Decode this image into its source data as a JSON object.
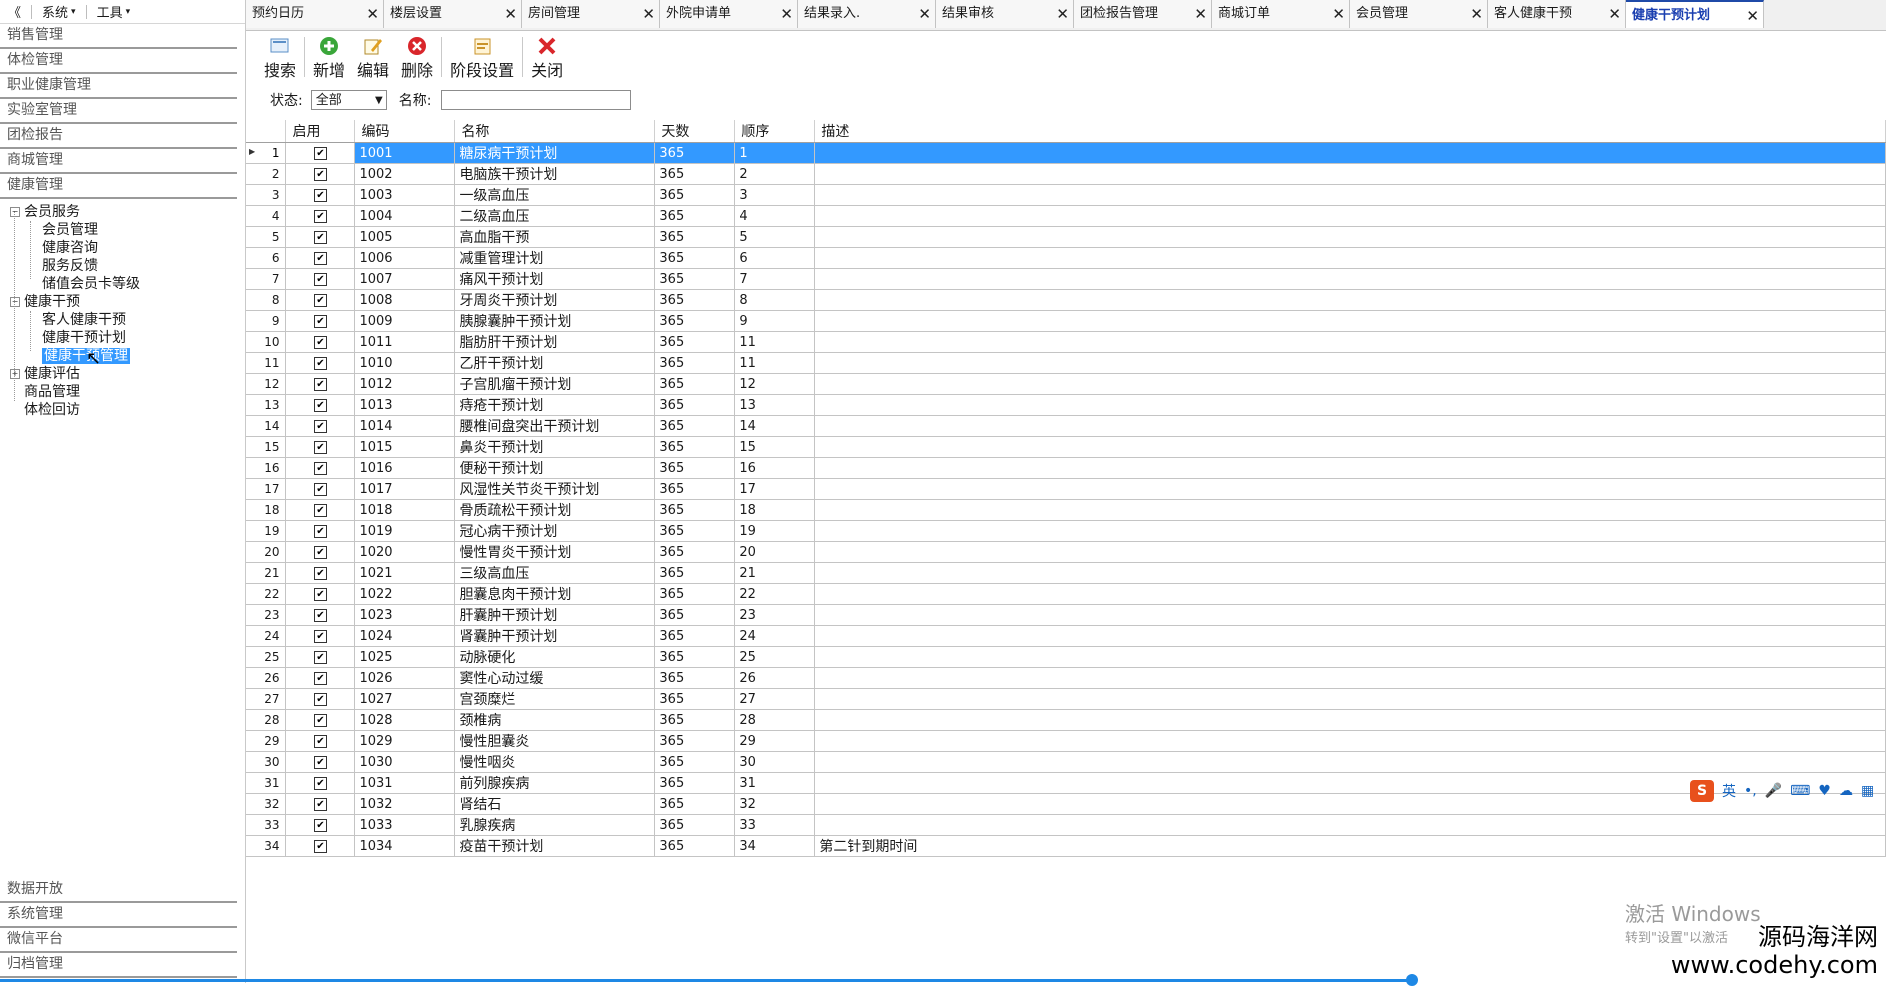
{
  "menubar": {
    "collapse": "《",
    "system": "系统",
    "tools": "工具"
  },
  "sidebar": {
    "top_groups": [
      "销售管理",
      "体检管理",
      "职业健康管理",
      "实验室管理",
      "团检报告",
      "商城管理",
      "健康管理"
    ],
    "tree": {
      "member_service": "会员服务",
      "member_children": [
        "会员管理",
        "健康咨询",
        "服务反馈",
        "储值会员卡等级"
      ],
      "health_intervention": "健康干预",
      "intervention_children": [
        "客人健康干预",
        "健康干预计划",
        "健康干预管理"
      ],
      "health_assessment": "健康评估",
      "product_management": "商品管理",
      "followup": "体检回访"
    },
    "bottom_groups": [
      "数据开放",
      "系统管理",
      "微信平台",
      "归档管理"
    ]
  },
  "tabs": [
    "预约日历",
    "楼层设置",
    "房间管理",
    "外院申请单",
    "结果录入.",
    "结果审核",
    "团检报告管理",
    "商城订单",
    "会员管理",
    "客人健康干预",
    "健康干预计划"
  ],
  "active_tab": "健康干预计划",
  "toolbar": {
    "search": "搜索",
    "add": "新增",
    "edit": "编辑",
    "delete": "删除",
    "stage": "阶段设置",
    "close": "关闭"
  },
  "filter": {
    "status_label": "状态:",
    "status_value": "全部",
    "name_label": "名称:",
    "name_value": ""
  },
  "grid": {
    "columns": [
      "启用",
      "编码",
      "名称",
      "天数",
      "顺序",
      "描述"
    ],
    "rows": [
      [
        "1",
        "1001",
        "糖尿病干预计划",
        "365",
        "1",
        ""
      ],
      [
        "2",
        "1002",
        "电脑族干预计划",
        "365",
        "2",
        ""
      ],
      [
        "3",
        "1003",
        "一级高血压",
        "365",
        "3",
        ""
      ],
      [
        "4",
        "1004",
        "二级高血压",
        "365",
        "4",
        ""
      ],
      [
        "5",
        "1005",
        "高血脂干预",
        "365",
        "5",
        ""
      ],
      [
        "6",
        "1006",
        "减重管理计划",
        "365",
        "6",
        ""
      ],
      [
        "7",
        "1007",
        "痛风干预计划",
        "365",
        "7",
        ""
      ],
      [
        "8",
        "1008",
        "牙周炎干预计划",
        "365",
        "8",
        ""
      ],
      [
        "9",
        "1009",
        "胰腺囊肿干预计划",
        "365",
        "9",
        ""
      ],
      [
        "10",
        "1011",
        "脂肪肝干预计划",
        "365",
        "11",
        ""
      ],
      [
        "11",
        "1010",
        "乙肝干预计划",
        "365",
        "11",
        ""
      ],
      [
        "12",
        "1012",
        "子宫肌瘤干预计划",
        "365",
        "12",
        ""
      ],
      [
        "13",
        "1013",
        "痔疮干预计划",
        "365",
        "13",
        ""
      ],
      [
        "14",
        "1014",
        "腰椎间盘突出干预计划",
        "365",
        "14",
        ""
      ],
      [
        "15",
        "1015",
        "鼻炎干预计划",
        "365",
        "15",
        ""
      ],
      [
        "16",
        "1016",
        "便秘干预计划",
        "365",
        "16",
        ""
      ],
      [
        "17",
        "1017",
        "风湿性关节炎干预计划",
        "365",
        "17",
        ""
      ],
      [
        "18",
        "1018",
        "骨质疏松干预计划",
        "365",
        "18",
        ""
      ],
      [
        "19",
        "1019",
        "冠心病干预计划",
        "365",
        "19",
        ""
      ],
      [
        "20",
        "1020",
        "慢性胃炎干预计划",
        "365",
        "20",
        ""
      ],
      [
        "21",
        "1021",
        "三级高血压",
        "365",
        "21",
        ""
      ],
      [
        "22",
        "1022",
        "胆囊息肉干预计划",
        "365",
        "22",
        ""
      ],
      [
        "23",
        "1023",
        "肝囊肿干预计划",
        "365",
        "23",
        ""
      ],
      [
        "24",
        "1024",
        "肾囊肿干预计划",
        "365",
        "24",
        ""
      ],
      [
        "25",
        "1025",
        "动脉硬化",
        "365",
        "25",
        ""
      ],
      [
        "26",
        "1026",
        "窦性心动过缓",
        "365",
        "26",
        ""
      ],
      [
        "27",
        "1027",
        "宫颈糜烂",
        "365",
        "27",
        ""
      ],
      [
        "28",
        "1028",
        "颈椎病",
        "365",
        "28",
        ""
      ],
      [
        "29",
        "1029",
        "慢性胆囊炎",
        "365",
        "29",
        ""
      ],
      [
        "30",
        "1030",
        "慢性咽炎",
        "365",
        "30",
        ""
      ],
      [
        "31",
        "1031",
        "前列腺疾病",
        "365",
        "31",
        ""
      ],
      [
        "32",
        "1032",
        "肾结石",
        "365",
        "32",
        ""
      ],
      [
        "33",
        "1033",
        "乳腺疾病",
        "365",
        "33",
        ""
      ],
      [
        "34",
        "1034",
        "疫苗干预计划",
        "365",
        "34",
        "第二针到期时间"
      ]
    ],
    "selected_row": 1
  },
  "ime": {
    "logo": "S",
    "lang": "英"
  },
  "watermark": {
    "title": "激活 Windows",
    "sub": "转到\"设置\"以激活"
  },
  "brand": {
    "name": "源码海洋网",
    "url": "www.codehy.com"
  },
  "colors": {
    "selection": "#3399ff",
    "active_tab_text": "#1a3fb0",
    "accent": "#1e88e5"
  }
}
